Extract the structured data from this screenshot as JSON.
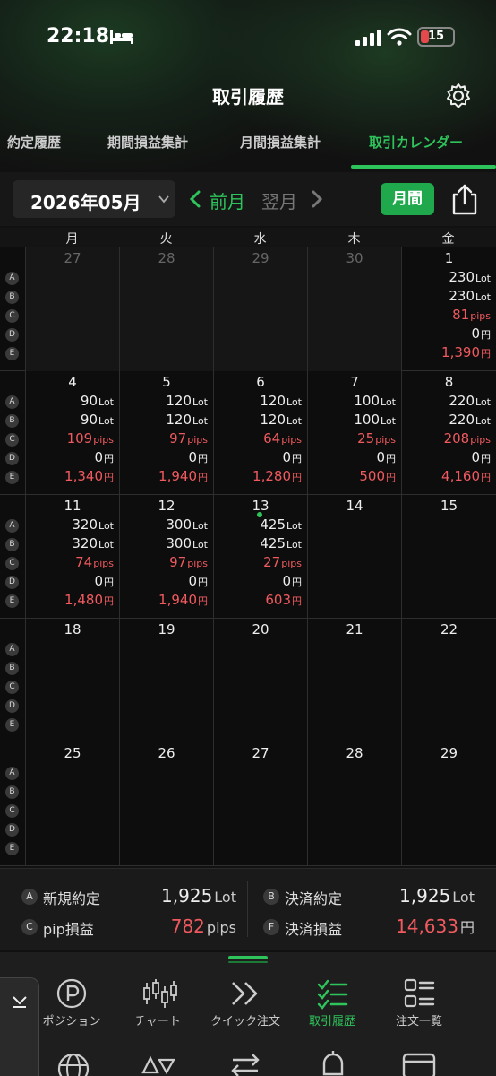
{
  "status_bar": {
    "time": "22:18",
    "battery": "15"
  },
  "header": {
    "title": "取引履歴"
  },
  "tabs": [
    {
      "label": "約定履歴"
    },
    {
      "label": "期間損益集計"
    },
    {
      "label": "月間損益集計"
    },
    {
      "label": "取引カレンダー"
    }
  ],
  "toolbar": {
    "month": "2026年05月",
    "prev_label": "前月",
    "next_label": "翌月",
    "yearly_label": "月間"
  },
  "calendar": {
    "weekdays": [
      "月",
      "火",
      "水",
      "木",
      "金"
    ],
    "legend": [
      "A",
      "B",
      "C",
      "D",
      "E"
    ],
    "units": {
      "lot": "Lot",
      "pips": "pips",
      "yen": "円"
    },
    "weeks": [
      {
        "days": [
          {
            "day": "27"
          },
          {
            "day": "28"
          },
          {
            "day": "29"
          },
          {
            "day": "30"
          },
          {
            "day": "1",
            "a": "230",
            "b": "230",
            "c": "81",
            "d": "0",
            "e": "1,390"
          }
        ]
      },
      {
        "days": [
          {
            "day": "4",
            "a": "90",
            "b": "90",
            "c": "109",
            "d": "0",
            "e": "1,340"
          },
          {
            "day": "5",
            "a": "120",
            "b": "120",
            "c": "97",
            "d": "0",
            "e": "1,940"
          },
          {
            "day": "6",
            "a": "120",
            "b": "120",
            "c": "64",
            "d": "0",
            "e": "1,280"
          },
          {
            "day": "7",
            "a": "100",
            "b": "100",
            "c": "25",
            "d": "0",
            "e": "500"
          },
          {
            "day": "8",
            "a": "220",
            "b": "220",
            "c": "208",
            "d": "0",
            "e": "4,160"
          }
        ]
      },
      {
        "days": [
          {
            "day": "11",
            "a": "320",
            "b": "320",
            "c": "74",
            "d": "0",
            "e": "1,480"
          },
          {
            "day": "12",
            "a": "300",
            "b": "300",
            "c": "97",
            "d": "0",
            "e": "1,940"
          },
          {
            "day": "13",
            "a": "425",
            "b": "425",
            "c": "27",
            "d": "0",
            "e": "603"
          },
          {
            "day": "14"
          },
          {
            "day": "15"
          }
        ]
      },
      {
        "days": [
          {
            "day": "18"
          },
          {
            "day": "19"
          },
          {
            "day": "20"
          },
          {
            "day": "21"
          },
          {
            "day": "22"
          }
        ]
      },
      {
        "days": [
          {
            "day": "25"
          },
          {
            "day": "26"
          },
          {
            "day": "27"
          },
          {
            "day": "28"
          },
          {
            "day": "29"
          }
        ]
      }
    ]
  },
  "summary": {
    "new_trades": {
      "badge": "A",
      "label": "新規約定",
      "value": "1,925",
      "unit": "Lot"
    },
    "settled_trades": {
      "badge": "B",
      "label": "決済約定",
      "value": "1,925",
      "unit": "Lot"
    },
    "pip_pl": {
      "badge": "C",
      "label": "pip損益",
      "value": "782",
      "unit": "pips"
    },
    "settled_pl": {
      "badge": "F",
      "label": "決済損益",
      "value": "14,633",
      "unit": "円"
    }
  },
  "bottom_nav": [
    {
      "label": "ポジション",
      "icon": "position-icon"
    },
    {
      "label": "チャート",
      "icon": "candlestick-icon"
    },
    {
      "label": "クイック注文",
      "icon": "quick-order-icon"
    },
    {
      "label": "取引履歴",
      "icon": "history-icon"
    },
    {
      "label": "注文一覧",
      "icon": "order-list-icon"
    }
  ],
  "colors": {
    "accent": "#2ec45b",
    "loss": "#f05a5f",
    "background": "#111111"
  }
}
